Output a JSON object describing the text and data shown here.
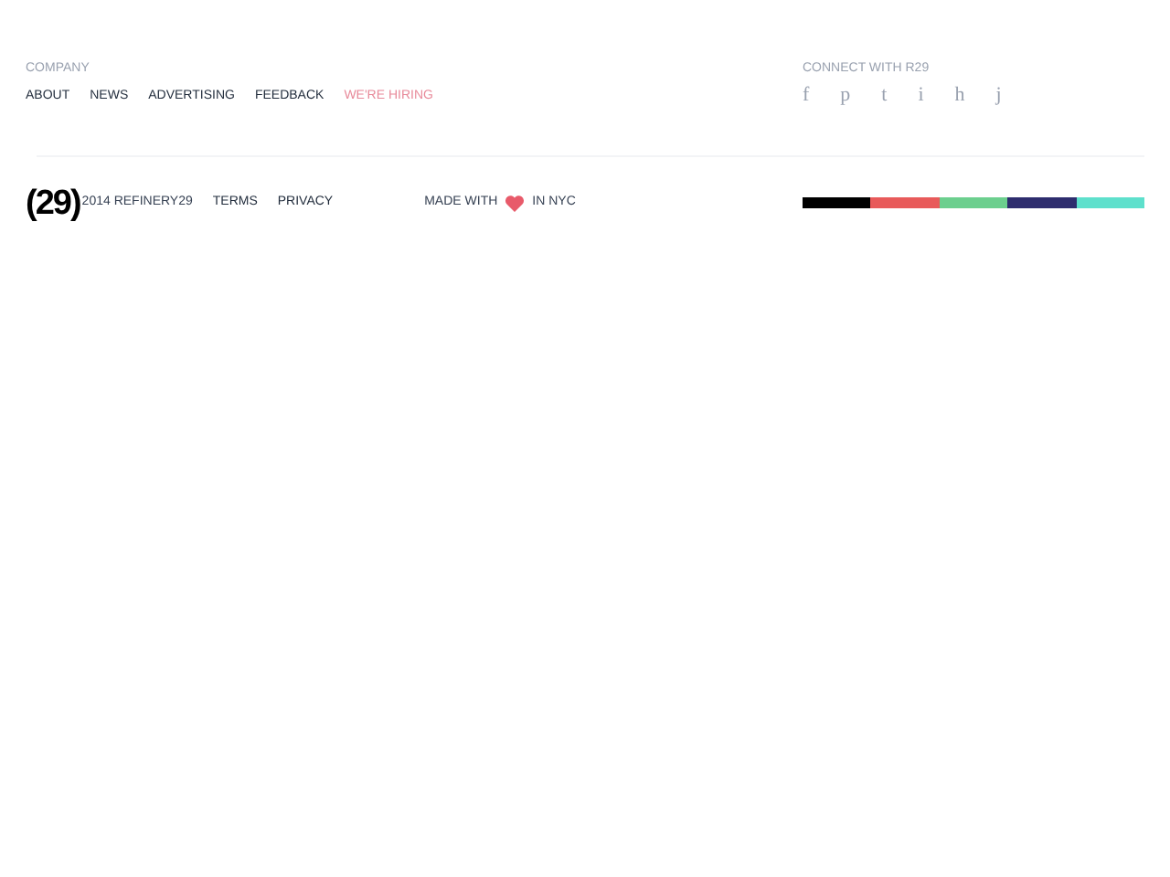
{
  "company": {
    "heading": "COMPANY",
    "links": [
      {
        "label": "ABOUT",
        "kind": "plain"
      },
      {
        "label": "NEWS",
        "kind": "plain"
      },
      {
        "label": "ADVERTISING",
        "kind": "plain"
      },
      {
        "label": "FEEDBACK",
        "kind": "plain"
      },
      {
        "label": "WE'RE HIRING",
        "kind": "highlight"
      }
    ]
  },
  "connect": {
    "heading": "CONNECT WITH R29",
    "icons": [
      "f",
      "p",
      "t",
      "i",
      "h",
      "j"
    ]
  },
  "bottom": {
    "logo": "(29)",
    "copyright": "2014 REFINERY29",
    "links": [
      "TERMS",
      "PRIVACY"
    ],
    "made_with": "MADE WITH",
    "made_in": "IN NYC",
    "stripes": [
      {
        "color": "#000000"
      },
      {
        "color": "#e85a5a"
      },
      {
        "color": "#6ccf8e"
      },
      {
        "color": "#2e2d6e"
      },
      {
        "color": "#5ee0cc"
      }
    ]
  }
}
